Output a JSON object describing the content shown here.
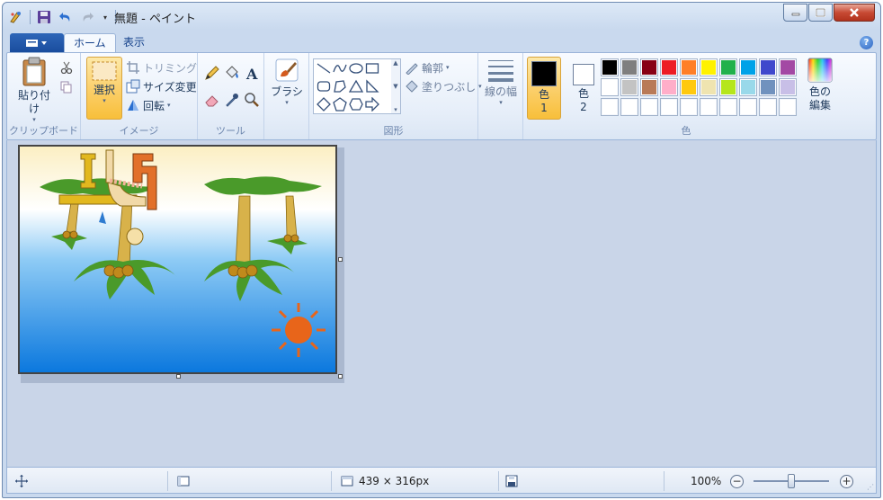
{
  "window": {
    "title": "無題 - ペイント"
  },
  "quick_access": {
    "icons": [
      "paint-app-icon",
      "save-icon",
      "undo-icon",
      "redo-icon",
      "customize-dropdown-icon"
    ]
  },
  "tabs": {
    "home": "ホーム",
    "view": "表示"
  },
  "clipboard": {
    "paste": "貼り付け",
    "group": "クリップボード"
  },
  "image": {
    "select": "選択",
    "crop": "トリミング",
    "resize": "サイズ変更",
    "rotate": "回転",
    "group": "イメージ"
  },
  "tools": {
    "group": "ツール"
  },
  "brushes": {
    "label": "ブラシ"
  },
  "shapes": {
    "outline": "輪郭",
    "fill": "塗りつぶし",
    "group": "図形"
  },
  "line_width": {
    "label": "線の幅"
  },
  "colors": {
    "color1_label": "色",
    "color1_num": "1",
    "color2_label": "色",
    "color2_num": "2",
    "edit_line1": "色の",
    "edit_line2": "編集",
    "group": "色",
    "color1": "#000000",
    "color2": "#ffffff",
    "palette_row1": [
      "#000000",
      "#7f7f7f",
      "#880015",
      "#ed1c24",
      "#ff7f27",
      "#fff200",
      "#22b14c",
      "#00a2e8",
      "#3f48cc",
      "#a349a4"
    ],
    "palette_row2": [
      "#ffffff",
      "#c3c3c3",
      "#b97a57",
      "#ffaec9",
      "#ffc90e",
      "#efe4b0",
      "#b5e61d",
      "#99d9ea",
      "#7092be",
      "#c8bfe7"
    ]
  },
  "status": {
    "image_size": "439 × 316px",
    "zoom": "100%",
    "zoom_out": "−",
    "zoom_in": "+"
  }
}
